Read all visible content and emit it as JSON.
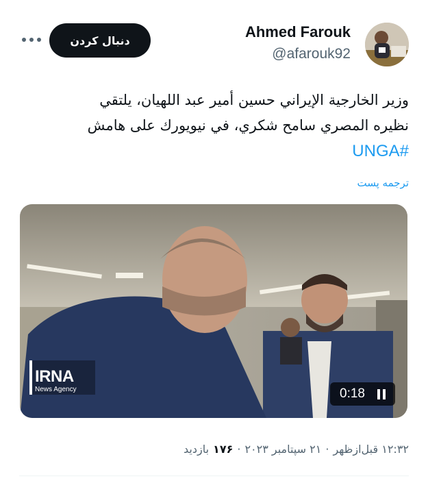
{
  "header": {
    "follow_label": "دنبال کردن",
    "display_name": "Ahmed Farouk",
    "handle": "@afarouk92"
  },
  "tweet": {
    "line1": "وزير الخارجية الإيراني حسين أمير عبد اللهيان، يلتقي",
    "line2": "نظيره المصري سامح شكري، في نيويورك على هامش",
    "hashtag": "#UNGA",
    "translate_label": "ترجمه پست"
  },
  "media": {
    "duration": "0:18",
    "watermark_title": "IRNA",
    "watermark_subtitle": "News Agency"
  },
  "meta": {
    "time": "۱۲:۳۲ قبل‌ازظهر",
    "date": "۲۱ سپتامبر ۲۰۲۳",
    "views_count": "۱۷۶",
    "views_label": "بازدید",
    "separator": "·"
  },
  "colors": {
    "accent": "#1d9bf0",
    "text": "#0f1419",
    "secondary": "#536471"
  },
  "icons": [
    "more-icon",
    "pause-icon"
  ]
}
